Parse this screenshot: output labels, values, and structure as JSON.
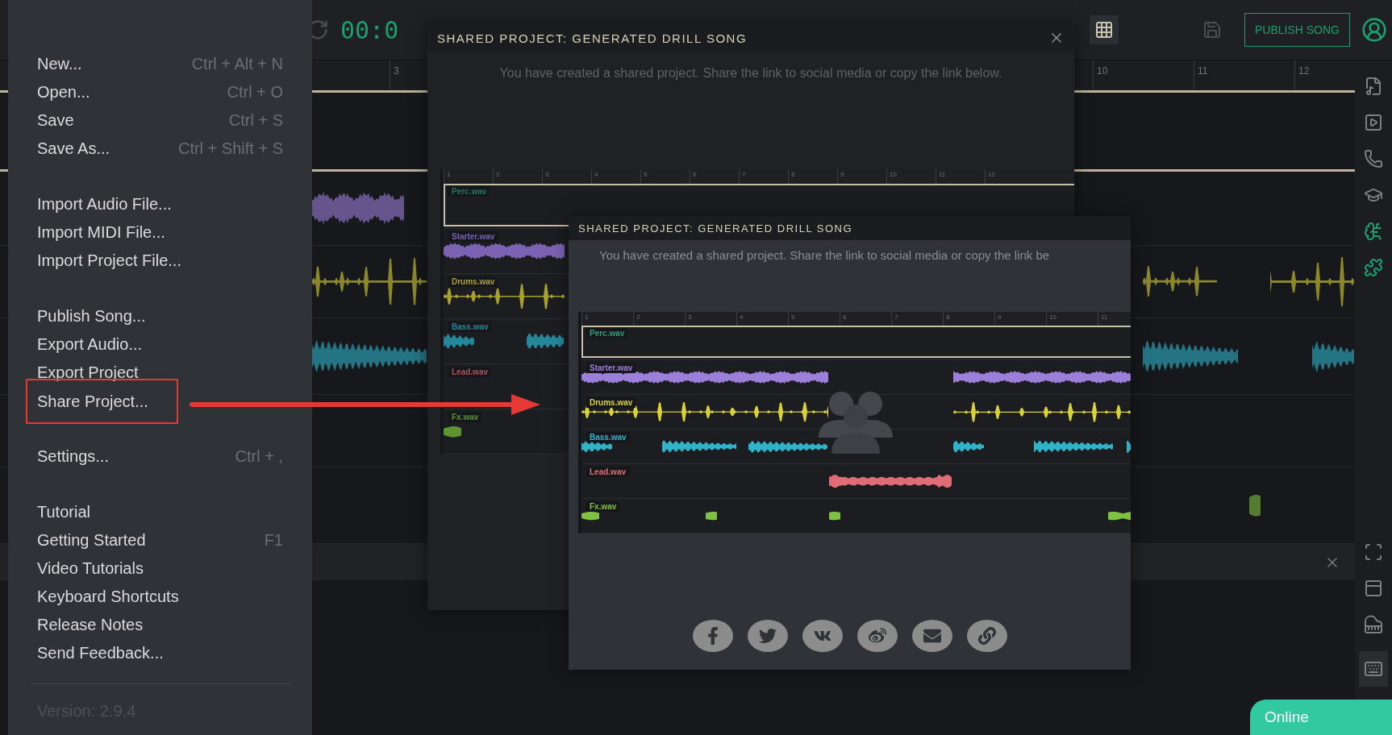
{
  "toolbar": {
    "time": "00:0",
    "publish_button": "PUBLISH SONG"
  },
  "ruler": [
    "3",
    "10",
    "11",
    "12"
  ],
  "menu": {
    "groups": [
      [
        {
          "label": "New...",
          "shortcut": "Ctrl + Alt + N",
          "annotated": false
        },
        {
          "label": "Open...",
          "shortcut": "Ctrl + O",
          "annotated": false
        },
        {
          "label": "Save",
          "shortcut": "Ctrl + S",
          "annotated": false
        },
        {
          "label": "Save As...",
          "shortcut": "Ctrl + Shift + S",
          "annotated": false
        }
      ],
      [
        {
          "label": "Import Audio File...",
          "annotated": false
        },
        {
          "label": "Import MIDI File...",
          "annotated": false
        },
        {
          "label": "Import Project File...",
          "annotated": false
        }
      ],
      [
        {
          "label": "Publish Song...",
          "annotated": false
        },
        {
          "label": "Export Audio...",
          "annotated": false
        },
        {
          "label": "Export Project",
          "annotated": false
        },
        {
          "label": "Share Project...",
          "annotated": true
        }
      ],
      [
        {
          "label": "Settings...",
          "shortcut": "Ctrl + ,",
          "annotated": false
        }
      ],
      [
        {
          "label": "Tutorial",
          "annotated": false
        },
        {
          "label": "Getting Started",
          "shortcut": "F1",
          "annotated": false
        },
        {
          "label": "Video Tutorials",
          "annotated": false
        },
        {
          "label": "Keyboard Shortcuts",
          "annotated": false
        },
        {
          "label": "Release Notes",
          "annotated": false
        },
        {
          "label": "Send Feedback...",
          "annotated": false
        }
      ]
    ],
    "version": "Version: 2.9.4"
  },
  "dialogs": [
    {
      "title": "SHARED PROJECT: GENERATED DRILL SONG",
      "message": "You have created a shared project. Share the link to social media or copy the link below.",
      "closable": true,
      "ruler": [
        "1",
        "2",
        "3",
        "4",
        "5",
        "6",
        "7",
        "8",
        "9",
        "10",
        "11",
        "12"
      ],
      "tracks": [
        {
          "name": "Perc.wav",
          "kind": "empty",
          "color": "#1f7a5c"
        },
        {
          "name": "Starter.wav",
          "kind": "pulse",
          "color": "#7b62b3"
        },
        {
          "name": "Drums.wav",
          "kind": "spike",
          "color": "#a8a12c"
        },
        {
          "name": "Bass.wav",
          "kind": "wedge",
          "color": "#24879a"
        },
        {
          "name": "Lead.wav",
          "kind": "noise",
          "color": "#a5545c"
        },
        {
          "name": "Fx.wav",
          "kind": "sparse",
          "color": "#5f9431"
        }
      ]
    },
    {
      "title": "SHARED PROJECT: GENERATED DRILL SONG",
      "message": "You have created a shared project. Share the link to social media or copy the link be",
      "closable": false,
      "ruler": [
        "1",
        "2",
        "3",
        "4",
        "5",
        "6",
        "7",
        "8",
        "9",
        "10",
        "11"
      ],
      "tracks": [
        {
          "name": "Perc.wav",
          "kind": "empty",
          "color": "#2aa078"
        },
        {
          "name": "Starter.wav",
          "kind": "pulse",
          "color": "#9b7fd9"
        },
        {
          "name": "Drums.wav",
          "kind": "spike",
          "color": "#d9d23a"
        },
        {
          "name": "Bass.wav",
          "kind": "wedge",
          "color": "#2fb3c9"
        },
        {
          "name": "Lead.wav",
          "kind": "noise",
          "color": "#e06c75"
        },
        {
          "name": "Fx.wav",
          "kind": "sparse",
          "color": "#7fc241"
        }
      ],
      "share_buttons": [
        {
          "kind": "facebook"
        },
        {
          "kind": "twitter"
        },
        {
          "kind": "vk"
        },
        {
          "kind": "weibo"
        },
        {
          "kind": "email"
        },
        {
          "kind": "link"
        }
      ]
    }
  ],
  "status": "Online"
}
